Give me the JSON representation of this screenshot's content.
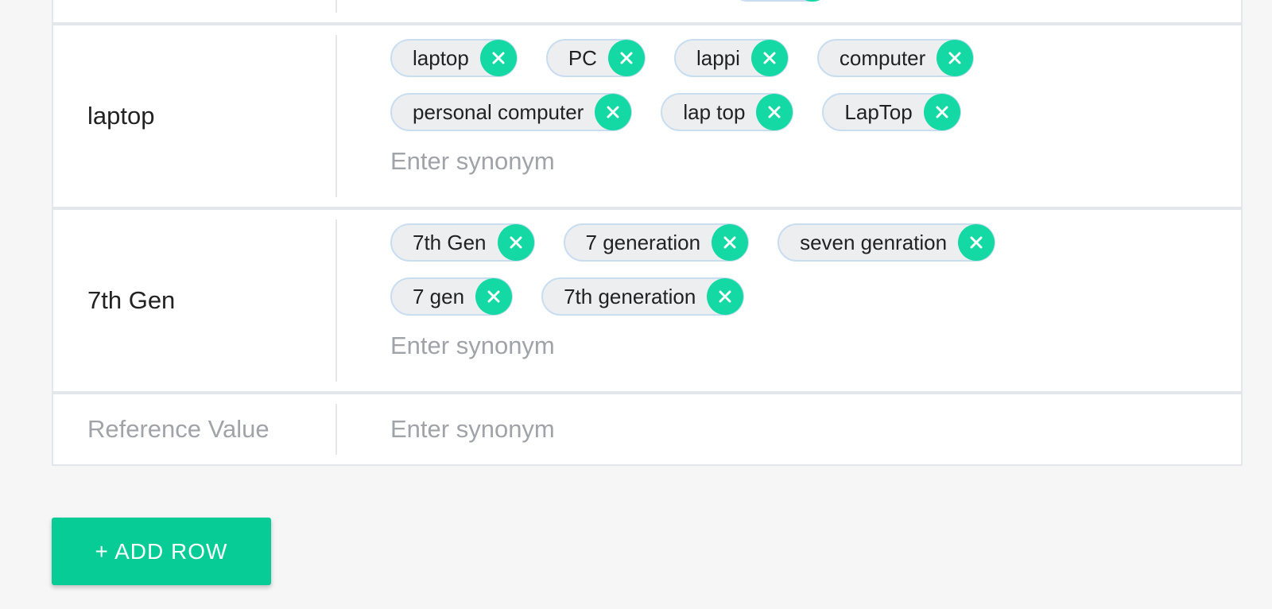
{
  "rows": [
    {
      "reference": "laptop",
      "synonyms": [
        "laptop",
        "PC",
        "lappi",
        "computer",
        "personal computer",
        "lap top",
        "LapTop"
      ],
      "lines": [
        [
          0,
          1,
          2,
          3
        ],
        [
          4,
          5,
          6
        ]
      ],
      "input_placeholder": "Enter synonym"
    },
    {
      "reference": "7th Gen",
      "synonyms": [
        "7th Gen",
        "7 generation",
        "seven genration",
        "7 gen",
        "7th generation"
      ],
      "lines": [
        [
          0,
          1,
          2
        ],
        [
          3,
          4
        ]
      ],
      "input_placeholder": "Enter synonym"
    }
  ],
  "new_row": {
    "reference_placeholder": "Reference Value",
    "input_placeholder": "Enter synonym"
  },
  "add_row_label": "+ ADD ROW",
  "colors": {
    "accent": "#07cc95",
    "chip_remove": "#15d9a4",
    "chip_bg": "#edeef0",
    "chip_border": "#c9ddf1"
  },
  "icons": {
    "chip_remove": "close-icon"
  }
}
